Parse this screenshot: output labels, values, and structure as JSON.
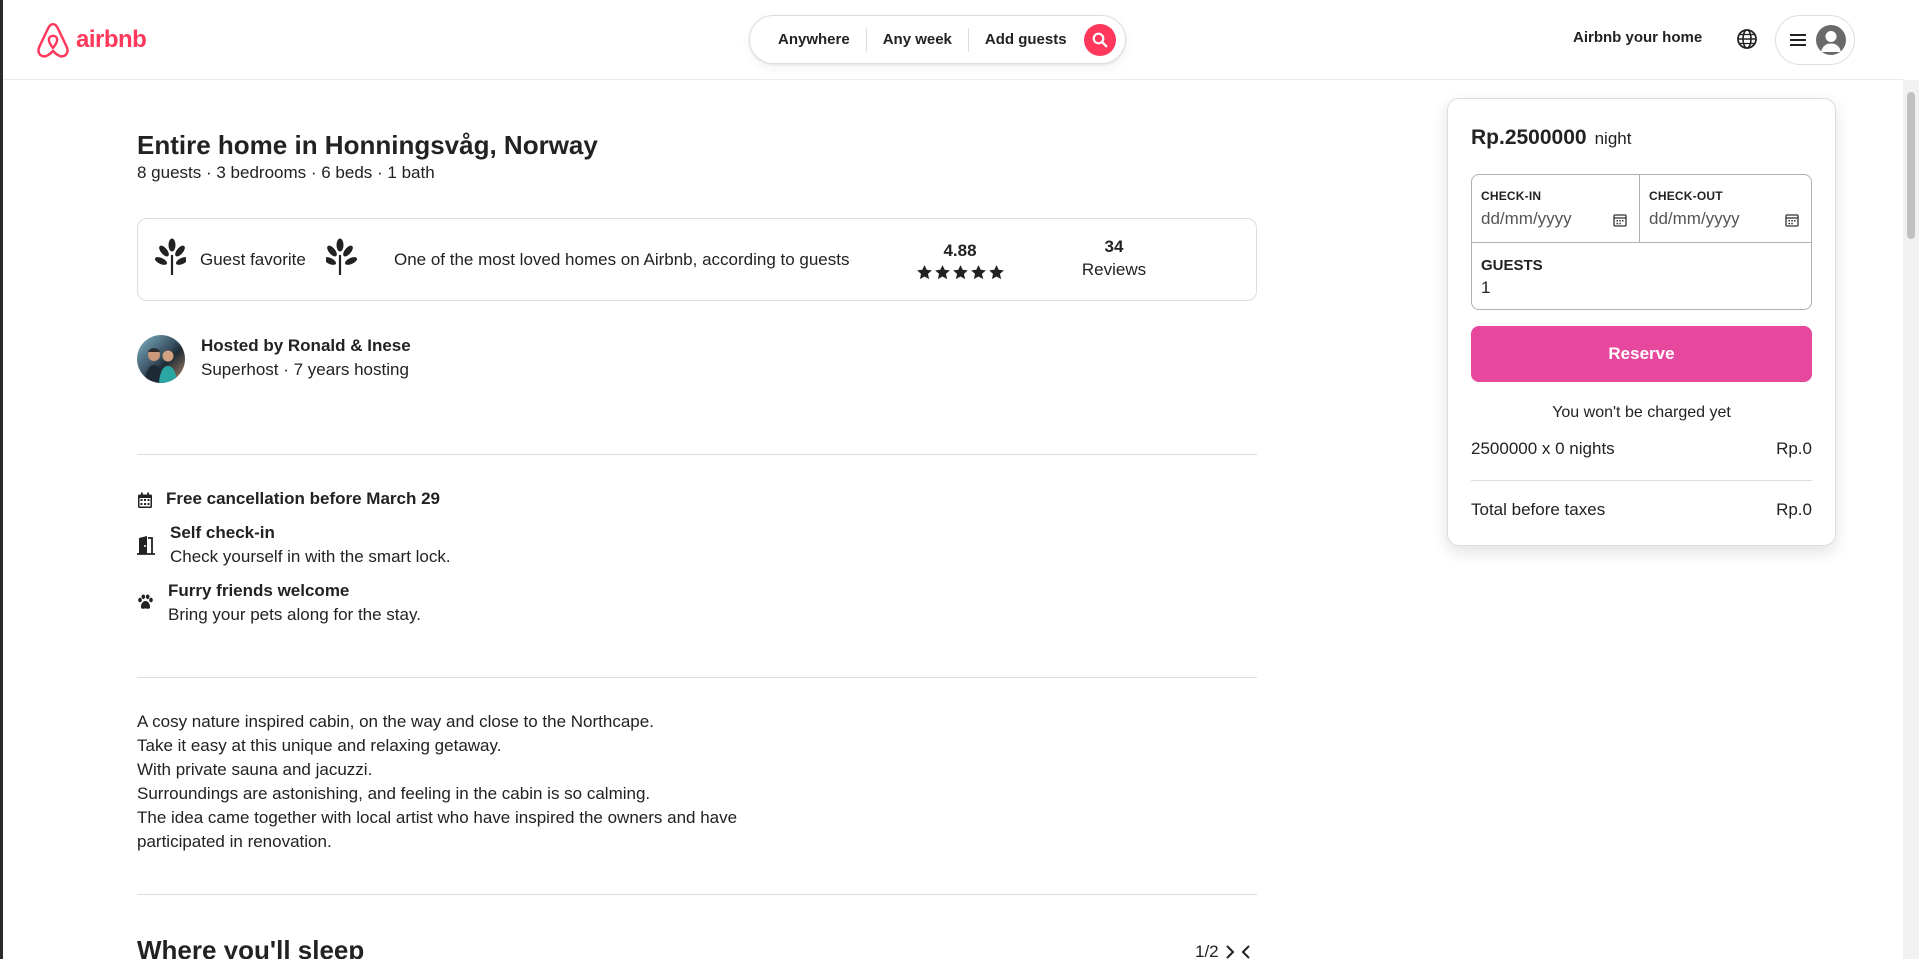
{
  "header": {
    "logo_text": "airbnb",
    "search": {
      "where": "Anywhere",
      "when": "Any week",
      "who": "Add guests"
    },
    "host_link": "Airbnb your home",
    "icons": [
      "airbnb-logo-icon",
      "search-icon",
      "globe-icon",
      "menu-icon",
      "user-icon"
    ]
  },
  "listing": {
    "title": "Entire home in Honningsvåg, Norway",
    "subtitle": "8 guests · 3 bedrooms · 6 beds · 1 bath",
    "favorite": {
      "label": "Guest favorite",
      "description": "One of the most loved homes on Airbnb, according to guests",
      "rating": "4.88",
      "stars": 5,
      "reviews_count": "34",
      "reviews_label": "Reviews"
    },
    "host": {
      "name": "Hosted by Ronald & Inese",
      "meta": "Superhost · 7 years hosting"
    },
    "features": [
      {
        "icon": "calendar-icon",
        "title": "Free cancellation before March 29",
        "desc": ""
      },
      {
        "icon": "door-icon",
        "title": "Self check-in",
        "desc": "Check yourself in with the smart lock."
      },
      {
        "icon": "paw-icon",
        "title": "Furry friends welcome",
        "desc": "Bring your pets along for the stay."
      }
    ],
    "description": [
      "A cosy nature inspired cabin, on the way and close to the Northcape.",
      "Take it easy at this unique and relaxing getaway.",
      "With private sauna and jacuzzi.",
      "Surroundings are astonishing, and feeling in the cabin is so calming.",
      "The idea came together with local artist who have inspired the owners and have",
      "participated in renovation."
    ],
    "sleep_title": "Where you'll sleep",
    "sleep_pager": "1/2"
  },
  "booking": {
    "price": "Rp.2500000",
    "price_unit": "night",
    "checkin_label": "CHECK-IN",
    "checkin_value": "dd/mm/yyyy",
    "checkout_label": "CHECK-OUT",
    "checkout_value": "dd/mm/yyyy",
    "guests_label": "GUESTS",
    "guests_value": "1",
    "reserve_label": "Reserve",
    "no_charge": "You won't be charged yet",
    "nights_label": "2500000 x 0 nights",
    "nights_value": "Rp.0",
    "total_label": "Total before taxes",
    "total_value": "Rp.0"
  },
  "colors": {
    "brand": "#ff385c",
    "reserve": "#e8479e",
    "text": "#222222",
    "border": "#dddddd"
  }
}
